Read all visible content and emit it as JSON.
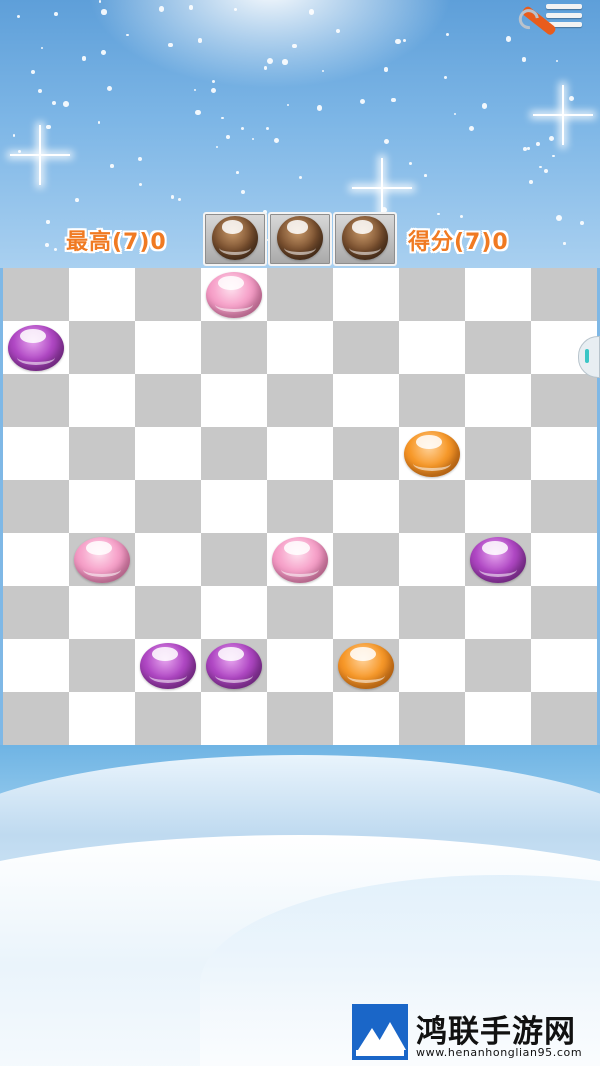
{
  "header": {
    "best_label": "最高(7)0",
    "score_label": "得分(7)0",
    "settings_icon": "wrench-menu-icon"
  },
  "next_balls": [
    "brown",
    "brown",
    "brown"
  ],
  "board": {
    "rows": 9,
    "cols": 9,
    "balls": [
      {
        "row": 0,
        "col": 3,
        "color": "pink"
      },
      {
        "row": 1,
        "col": 0,
        "color": "purple"
      },
      {
        "row": 3,
        "col": 6,
        "color": "orange"
      },
      {
        "row": 5,
        "col": 1,
        "color": "pink"
      },
      {
        "row": 5,
        "col": 4,
        "color": "pink"
      },
      {
        "row": 5,
        "col": 7,
        "color": "purple"
      },
      {
        "row": 7,
        "col": 2,
        "color": "purple"
      },
      {
        "row": 7,
        "col": 3,
        "color": "purple"
      },
      {
        "row": 7,
        "col": 5,
        "color": "orange"
      }
    ]
  },
  "watermark": {
    "title": "鸿联手游网",
    "url": "www.henanhonglian95.com"
  },
  "colors": {
    "score_text": "#f07a22",
    "light_cell": "#ffffff",
    "dark_cell": "#c8c8c8"
  }
}
